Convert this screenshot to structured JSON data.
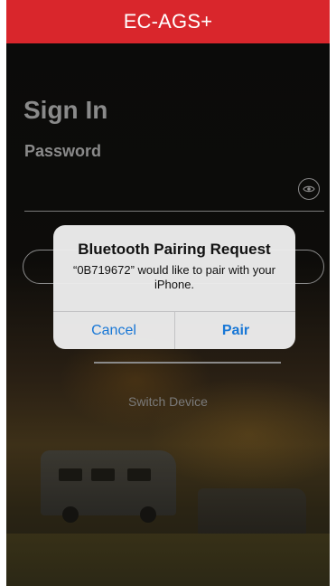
{
  "header": {
    "title": "EC-AGS+"
  },
  "signin": {
    "title": "Sign In",
    "password_label": "Password",
    "password_value": "",
    "show_password_icon": "eye-icon"
  },
  "switch_device_label": "Switch Device",
  "dialog": {
    "title": "Bluetooth Pairing Request",
    "message": "“0B719672” would like to pair with your iPhone.",
    "cancel_label": "Cancel",
    "pair_label": "Pair",
    "button_color": "#1877d6"
  },
  "colors": {
    "header_bg": "#d9262c",
    "background": "#0c0c0b",
    "muted_text": "#8a8a8a"
  }
}
